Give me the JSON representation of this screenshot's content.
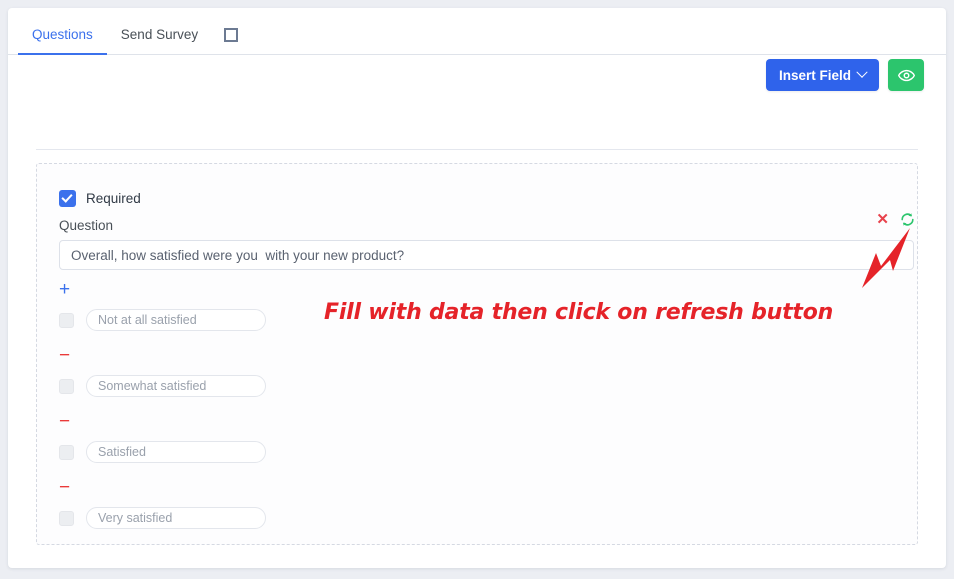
{
  "tabs": [
    {
      "label": "Questions",
      "active": true
    },
    {
      "label": "Send Survey",
      "active": false
    }
  ],
  "tab_expand_icon": "expand-icon",
  "toolbar": {
    "insert_field_label": "Insert Field",
    "insert_field_chevron": "chevron-down-icon",
    "preview_icon": "eye-icon",
    "insert_field_color": "#2f63eb",
    "preview_color": "#2cc56d"
  },
  "question": {
    "required_label": "Required",
    "required_checked": true,
    "question_label": "Question",
    "question_value": "Overall, how satisfied were you  with your new product?",
    "delete_icon": "close-x-icon",
    "refresh_icon": "refresh-icon",
    "delete_color": "#e8424c",
    "refresh_color": "#2cc56d",
    "add_option_icon": "plus-icon",
    "remove_option_icon": "minus-icon",
    "options": [
      {
        "placeholder": "Not at all satisfied",
        "checked": false
      },
      {
        "placeholder": "Somewhat satisfied",
        "checked": false
      },
      {
        "placeholder": "Satisfied",
        "checked": false
      },
      {
        "placeholder": "Very satisfied",
        "checked": false
      }
    ]
  },
  "annotation": {
    "text": "Fill with data then click on refresh button",
    "color": "#e52329",
    "arrow": "arrow-pointing-to-refresh-button"
  }
}
